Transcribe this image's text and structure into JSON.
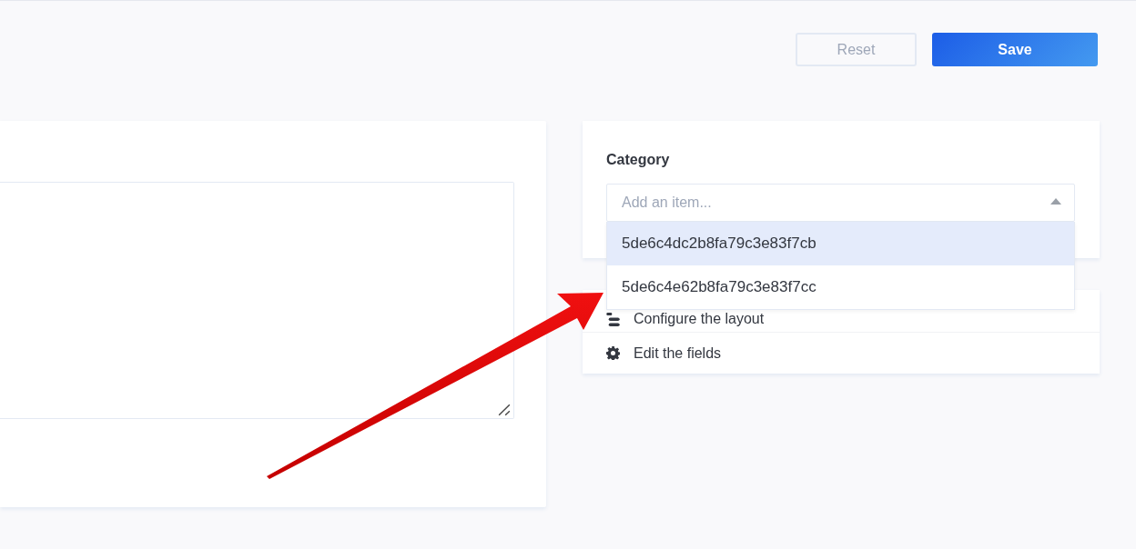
{
  "actions": [
    {
      "label": "Reset",
      "kind": "secondary",
      "disabled": true
    },
    {
      "label": "Save",
      "kind": "primary",
      "disabled": false
    }
  ],
  "category": {
    "label": "Category",
    "placeholder": "Add an item...",
    "expanded": true,
    "options": [
      {
        "label": "5de6c4dc2b8fa79c3e83f7cb",
        "selected": true
      },
      {
        "label": "5de6c4e62b8fa79c3e83f7cc",
        "selected": false
      }
    ]
  },
  "links": [
    {
      "label": "Configure the layout",
      "kind": "layout"
    },
    {
      "label": "Edit the fields",
      "kind": "settings"
    }
  ]
}
